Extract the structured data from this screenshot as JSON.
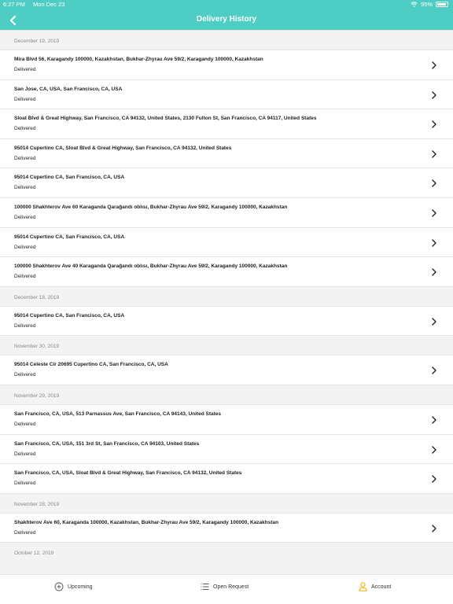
{
  "status_bar": {
    "time": "6:27 PM",
    "date": "Mon Dec 23",
    "battery": "95%"
  },
  "header": {
    "title": "Delivery History"
  },
  "groups": [
    {
      "date": "December 19, 2019",
      "items": [
        {
          "address": "Mira Blvd 56, Karagandy 100000, Kazakhstan, Bukhar-Zhyrau Ave 59/2, Karagandy 100000, Kazakhstan",
          "status": "Delivered"
        },
        {
          "address": "San Jose, CA, USA, San Francisco, CA, USA",
          "status": "Delivered"
        },
        {
          "address": "Sloat Blvd & Great Highway, San Francisco, CA 94132, United States, 2130 Fulton St, San Francisco, CA 94117, United States",
          "status": "Delivered"
        },
        {
          "address": "95014  Cupertino CA, Sloat Blvd & Great Highway, San Francisco, CA 94132, United States",
          "status": "Delivered"
        },
        {
          "address": "95014  Cupertino CA, San Francisco, CA, USA",
          "status": "Delivered"
        },
        {
          "address": "100000 Shakhterov Ave 60 Karaganda Qarağandı oblısı, Bukhar-Zhyrau Ave 59/2, Karagandy 100000, Kazakhstan",
          "status": "Delivered"
        },
        {
          "address": "95014  Cupertino CA, San Francisco, CA, USA",
          "status": "Delivered"
        },
        {
          "address": "100000 Shakhterov Ave 40 Karaganda Qarağandı oblısı, Bukhar-Zhyrau Ave 59/2, Karagandy 100000, Kazakhstan",
          "status": "Delivered"
        }
      ]
    },
    {
      "date": "December 18, 2019",
      "items": [
        {
          "address": "95014  Cupertino CA, San Francisco, CA, USA",
          "status": "Delivered"
        }
      ]
    },
    {
      "date": "November 30, 2019",
      "items": [
        {
          "address": "95014 Celeste Cir 20695 Cupertino CA, San Francisco, CA, USA",
          "status": "Delivered"
        }
      ]
    },
    {
      "date": "November 29, 2019",
      "items": [
        {
          "address": "San Francisco, CA, USA, 513 Parnassus Ave, San Francisco, CA 94143, United States",
          "status": "Delivered"
        },
        {
          "address": "San Francisco, CA, USA, 151 3rd St, San Francisco, CA 94103, United States",
          "status": "Delivered"
        },
        {
          "address": "San Francisco, CA, USA, Sloat Blvd & Great Highway, San Francisco, CA 94132, United States",
          "status": "Delivered"
        }
      ]
    },
    {
      "date": "November 28, 2019",
      "items": [
        {
          "address": "Shakhterov Ave 60, Karaganda 100000, Kazakhstan, Bukhar-Zhyrau Ave 59/2, Karagandy 100000, Kazakhstan",
          "status": "Delivered"
        }
      ]
    },
    {
      "date": "October 12, 2019",
      "items": []
    }
  ],
  "tabbar": {
    "upcoming": "Upcoming",
    "open_request": "Open Request",
    "account": "Account"
  },
  "colors": {
    "accent": "#4ecdc4",
    "account_icon": "#f0b400"
  },
  "icons": {
    "back": "chevron-left-icon",
    "row": "chevron-right-icon",
    "upcoming": "plus-circle-icon",
    "open_request": "list-icon",
    "account": "user-icon",
    "wifi": "wifi-icon",
    "battery": "battery-icon"
  }
}
